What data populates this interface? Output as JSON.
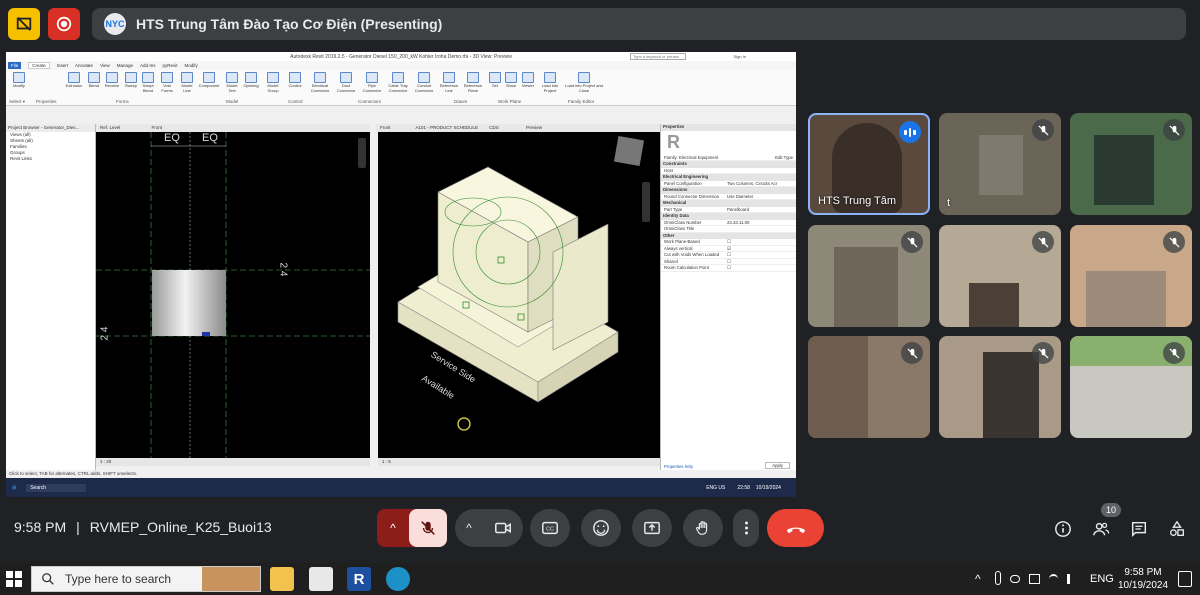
{
  "meet_title": "HTS Trung Tâm Đào Tạo Cơ Điện (Presenting)",
  "logo_text": "NYC",
  "revit": {
    "window_title": "Autodesk Revit 2019.2.5 - Generator Diesel 150_200_kW Kohler Iroha Demo.rfa - 3D View: Preview",
    "search_placeholder": "Type a keyword or phrase",
    "sign_in": "Sign In",
    "tabs": [
      "File",
      "Create",
      "Insert",
      "Annotate",
      "View",
      "Manage",
      "Add-Ins",
      "pyRevit",
      "Modify"
    ],
    "ribbon_buttons": [
      "Modify",
      "Extrusion",
      "Blend",
      "Revolve",
      "Sweep",
      "Swept Blend",
      "Void Forms",
      "Model Line",
      "Component",
      "Model Text",
      "Opening",
      "Model Group",
      "Control",
      "Electrical Connector",
      "Duct Connector",
      "Pipe Connector",
      "Cable Tray Connector",
      "Conduit Connector",
      "Reference Line",
      "Reference Plane",
      "Set",
      "Show",
      "Viewer",
      "Load into Project",
      "Load into Project and Close"
    ],
    "ribbon_groups": [
      "Select ▾",
      "Properties",
      "Forms",
      "Model",
      "Control",
      "Connectors",
      "Datum",
      "Work Plane",
      "Family Editor"
    ],
    "project_browser_title": "Project Browser - Generator_Dies...",
    "browser_items": [
      "Views (all)",
      "Sheets (all)",
      "Families",
      "Groups",
      "Revit Links"
    ],
    "view_tabs": [
      "Ref. Level",
      "Front",
      "Front",
      "A101 - PRODUCT SCHEDULE",
      "CDS",
      "Preview"
    ],
    "left_view_labels": {
      "eq1": "EQ",
      "eq2": "EQ",
      "dim_right": "2 4",
      "dim_left": "2 4"
    },
    "right_view_labels": {
      "service": "Service Side",
      "available": "Available"
    },
    "left_scale": "1 : 20",
    "right_scale": "1 : 5",
    "properties": {
      "title": "Properties",
      "family": "Family: Electrical Equipment",
      "edit_type": "Edit Type",
      "sections": [
        {
          "name": "Constraints",
          "rows": [
            [
              "Host",
              ""
            ]
          ]
        },
        {
          "name": "Electrical Engineering",
          "rows": [
            [
              "Panel Configuration",
              "Two Columns, Circuits Acr"
            ]
          ]
        },
        {
          "name": "Dimensions",
          "rows": [
            [
              "Round Connector Dimension",
              "Use Diameter"
            ]
          ]
        },
        {
          "name": "Mechanical",
          "rows": [
            [
              "Part Type",
              "Panelboard"
            ]
          ]
        },
        {
          "name": "Identity Data",
          "rows": [
            [
              "OmniClass Number",
              "23.33.11.00"
            ],
            [
              "OmniClass Title",
              ""
            ]
          ]
        },
        {
          "name": "Other",
          "rows": [
            [
              "Work Plane-Based",
              "☐"
            ],
            [
              "Always vertical",
              "☑"
            ],
            [
              "Cut with Voids When Loaded",
              "☐"
            ],
            [
              "Shared",
              "☐"
            ],
            [
              "Room Calculation Point",
              "☐"
            ]
          ]
        }
      ],
      "help": "Properties help",
      "apply": "Apply"
    },
    "status": "Click to select, TAB for alternates, CTRL adds, SHIFT unselects.",
    "win_search": "Search",
    "win_lang": "ENG US",
    "win_time": "22:58",
    "win_date": "10/19/2024"
  },
  "participants": [
    {
      "name": "HTS Trung Tâm",
      "speaking": true
    },
    {
      "name": "t",
      "speaking": false
    },
    {
      "name": "",
      "speaking": false
    },
    {
      "name": "",
      "speaking": false
    },
    {
      "name": "",
      "speaking": false
    },
    {
      "name": "",
      "speaking": false
    },
    {
      "name": "",
      "speaking": false
    },
    {
      "name": "",
      "speaking": false
    },
    {
      "name": "",
      "speaking": false
    }
  ],
  "bottom": {
    "time": "9:58 PM",
    "separator": "|",
    "meeting": "RVMEP_Online_K25_Buoi13",
    "people_count": "10"
  },
  "taskbar": {
    "search_placeholder": "Type here to search",
    "lang": "ENG",
    "time": "9:58 PM",
    "date": "10/19/2024"
  },
  "colors": {
    "leave": "#ea4335",
    "mic_off": "#f9dedc",
    "accent": "#1a73e8"
  }
}
